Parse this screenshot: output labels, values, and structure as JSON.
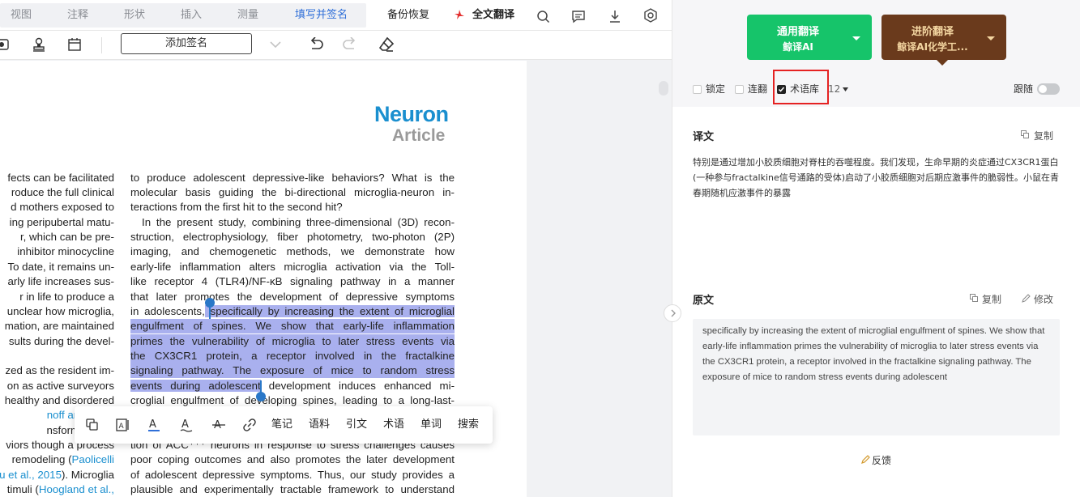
{
  "toolbar": {
    "tabs": [
      "视图",
      "注释",
      "形状",
      "插入",
      "测量",
      "填写并签名"
    ],
    "backup": "备份恢复",
    "fulltext": "全文翻译",
    "signature": "添加签名"
  },
  "document": {
    "logo_line1": "Neuron",
    "logo_line2": "Article",
    "left_lines": [
      "fects can be facilitated",
      "roduce the full clinical",
      "d mothers exposed to",
      "ing peripubertal matu-",
      "r, which can be pre-",
      "inhibitor minocycline",
      "To date, it remains un-",
      "arly life increases sus-",
      "r in life to produce a",
      "unclear how microglia,",
      "mation, are maintained",
      "sults during the devel-",
      "",
      "zed as the resident im-",
      "on as active surveyors",
      "healthy and disordered",
      "",
      "nsforming into",
      "viors though a process",
      "remodeling (",
      "u et al., 2015). Microglia",
      "timuli ("
    ],
    "cite_a": "noff and Perry",
    "cite_b": "Paolicelli",
    "cite_c": "u et al., 2015",
    "cite_d": "Hoogland et al.,",
    "r1": "to produce adolescent depressive-like behaviors? What is the",
    "r2": "molecular basis guiding the bi-directional microglia-neuron in-",
    "r3": "teractions from the first hit to the second hit?",
    "r4": "In the present study, combining three-dimensional (3D) recon-",
    "r5": "struction, electrophysiology, fiber photometry, two-photon (2P)",
    "r6": "imaging, and chemogenetic methods, we demonstrate how",
    "r7": "early-life inflammation alters microglia activation via the Toll-",
    "r8": "like receptor 4 (TLR4)/NF-κB signaling pathway in a manner",
    "r9": "that later promotes the development of depressive symptoms",
    "r10a": "in adolescents,",
    "r10b": " specifically by increasing the extent of microglial",
    "r11": "engulfment of spines. We show that early-life inflammation",
    "r12": "primes the vulnerability of microglia to later stress events via",
    "r13": "the CX3CR1 protein, a receptor involved in the fractalkine",
    "r14": "signaling pathway. The exposure of mice to random stress",
    "r15a": "events during adolescent",
    "r15b": " development induces enhanced mi-",
    "r16": "croglial engulfment of developing spines, leading to a long-last-",
    "r18": "tion of ACC⁺⁺⁺ neurons in response to stress challenges causes",
    "r19": "poor coping outcomes and also promotes the later development",
    "r20": "of adolescent depressive symptoms. Thus, our study provides a",
    "r21": "plausible and experimentally tractable framework to understand"
  },
  "popup": {
    "items": [
      "笔记",
      "语料",
      "引文",
      "术语",
      "单词",
      "搜索"
    ]
  },
  "panel": {
    "btn_general_title": "通用翻译",
    "btn_general_sub": "鲸译AI",
    "btn_advanced_title": "进阶翻译",
    "btn_advanced_sub": "鲸译AI化学工...",
    "opt_lock": "锁定",
    "opt_continuous": "连翻",
    "opt_glossary": "术语库",
    "opt_fontsize": "12",
    "opt_follow": "跟随",
    "translation_title": "译文",
    "copy": "复制",
    "translation_text": "特别是通过增加小胶质细胞对脊柱的吞噬程度。我们发现，生命早期的炎症通过CX3CR1蛋白(一种参与fractalkine信号通路的受体)启动了小胶质细胞对后期应激事件的脆弱性。小鼠在青春期随机应激事件的暴露",
    "source_title": "原文",
    "edit": "修改",
    "source_text": "specifically by increasing the extent of microglial engulfment of spines. We show that early-life inflammation primes the vulnerability of microglia to later stress events via the CX3CR1 protein, a receptor involved in the fractalkine signaling pathway. The exposure of mice to random stress events during adolescent",
    "feedback": "反馈"
  },
  "colors": {
    "accent_blue": "#2f6fd8",
    "green": "#16c46a",
    "brown": "#6a3a1c",
    "highlight": "#a9b0ee",
    "red_box": "#e52222"
  }
}
